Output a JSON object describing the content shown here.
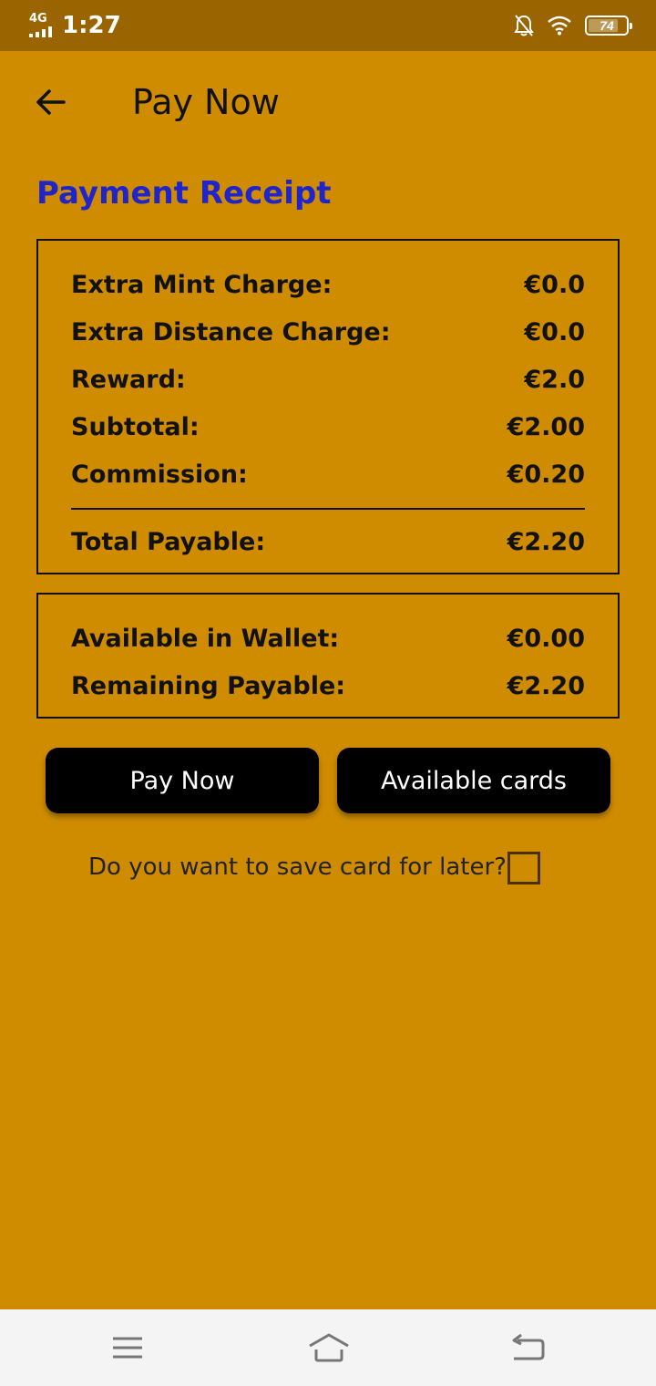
{
  "status_bar": {
    "network": "4G",
    "time": "1:27",
    "battery": "74"
  },
  "app_bar": {
    "title": "Pay Now"
  },
  "receipt": {
    "title": "Payment Receipt",
    "rows": [
      {
        "label": "Extra Mint Charge:",
        "value": "€0.0"
      },
      {
        "label": "Extra Distance Charge:",
        "value": "€0.0"
      },
      {
        "label": "Reward:",
        "value": "€2.0"
      },
      {
        "label": "Subtotal:",
        "value": "€2.00"
      },
      {
        "label": "Commission:",
        "value": "€0.20"
      }
    ],
    "total": {
      "label": "Total Payable:",
      "value": "€2.20"
    }
  },
  "wallet": {
    "rows": [
      {
        "label": "Available in Wallet:",
        "value": "€0.00"
      },
      {
        "label": "Remaining Payable:",
        "value": "€2.20"
      }
    ]
  },
  "actions": {
    "pay_now_label": "Pay Now",
    "available_cards_label": "Available cards"
  },
  "save_card": {
    "label": "Do you want to save card for later?",
    "checked": false
  },
  "colors": {
    "background": "#cf8c00",
    "status_bar": "#9a6500",
    "title_accent": "#1f25c8"
  },
  "icons": {
    "back": "arrow-left-icon",
    "nav_menu": "menu-icon",
    "nav_home": "home-icon",
    "nav_back": "back-icon"
  }
}
